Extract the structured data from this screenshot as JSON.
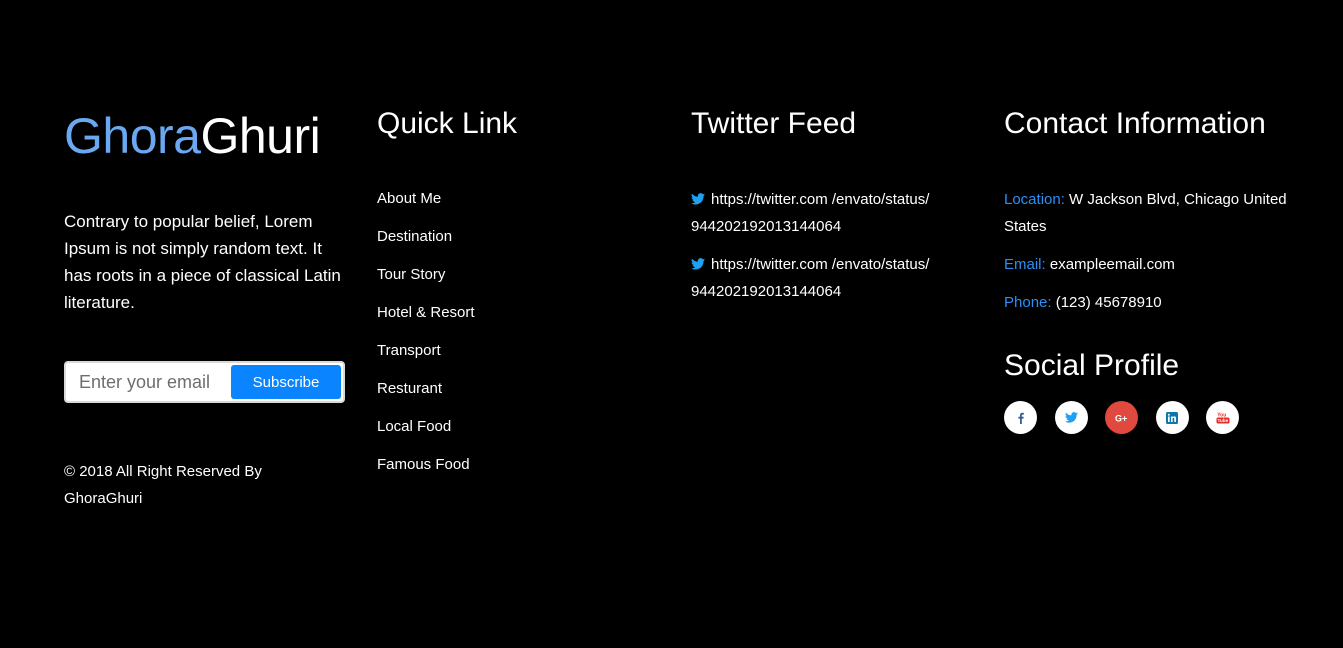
{
  "brand": {
    "logo_part1": "Ghora",
    "logo_part2": "Ghuri",
    "description": "Contrary to popular belief, Lorem Ipsum is not simply random text. It has roots in a piece of classical Latin literature.",
    "copyright": "© 2018 All Right Reserved By GhoraGhuri"
  },
  "subscribe": {
    "placeholder": "Enter your email",
    "value": "",
    "button_label": "Subscribe"
  },
  "quick_links": {
    "title": "Quick Link",
    "items": [
      "About Me",
      "Destination",
      "Tour Story",
      "Hotel & Resort",
      "Transport",
      "Resturant",
      "Local Food",
      "Famous Food"
    ]
  },
  "twitter": {
    "title": "Twitter Feed",
    "icon": "twitter-bird-icon",
    "tweets": [
      "https://twitter.com /envato/status/ 944202192013144064",
      "https://twitter.com /envato/status/ 944202192013144064"
    ]
  },
  "contact": {
    "title": "Contact Information",
    "location_label": "Location:",
    "location_value": " W Jackson Blvd, Chicago United States",
    "email_label": "Email:",
    "email_value": " exampleemail.com",
    "phone_label": "Phone:",
    "phone_value": " (123) 45678910"
  },
  "social": {
    "title": "Social Profile",
    "icons": [
      {
        "name": "facebook-icon",
        "glyph": "f",
        "color": "#3b5998"
      },
      {
        "name": "twitter-icon",
        "glyph": "t",
        "color": "#1da1f2"
      },
      {
        "name": "google-plus-icon",
        "glyph": "G+",
        "color": "#ffffff"
      },
      {
        "name": "linkedin-icon",
        "glyph": "in",
        "color": "#0e76a8"
      },
      {
        "name": "youtube-icon",
        "glyph": "You",
        "color": "#e52d27"
      }
    ]
  },
  "colors": {
    "background": "#000000",
    "accent_blue": "#2a8ff7",
    "logo_blue": "#6aa9f2",
    "button_blue": "#0a84ff"
  }
}
